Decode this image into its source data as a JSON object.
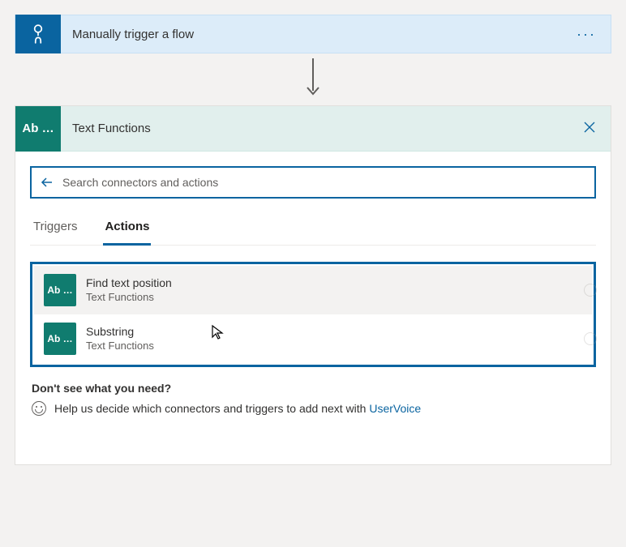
{
  "trigger": {
    "title": "Manually trigger a flow",
    "menu_glyph": "···",
    "icon_label": "tap"
  },
  "action": {
    "icon_label": "Ab …",
    "title": "Text Functions",
    "search_placeholder": "Search connectors and actions",
    "tabs": {
      "triggers": "Triggers",
      "actions": "Actions"
    },
    "results": [
      {
        "icon": "Ab …",
        "title": "Find text position",
        "sub": "Text Functions"
      },
      {
        "icon": "Ab …",
        "title": "Substring",
        "sub": "Text Functions"
      }
    ],
    "footer": {
      "heading": "Don't see what you need?",
      "text_prefix": "Help us decide which connectors and triggers to add next with ",
      "link": "UserVoice"
    }
  }
}
